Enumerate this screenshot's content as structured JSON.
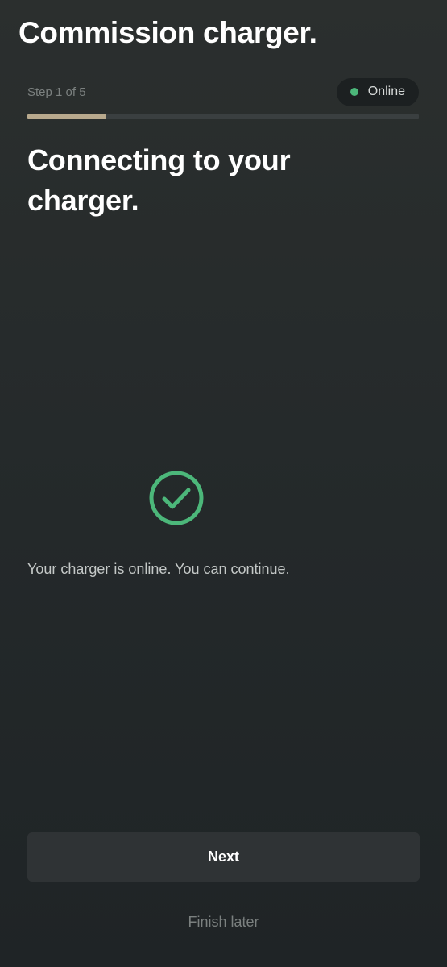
{
  "header": {
    "title": "Commission charger."
  },
  "progress": {
    "step_label": "Step 1 of 5",
    "current_step": 1,
    "total_steps": 5,
    "fraction": 0.2,
    "fill_color": "#b8a98d"
  },
  "status": {
    "label": "Online",
    "dot_color": "#4cb77a"
  },
  "main": {
    "heading": "Connecting to your charger.",
    "icon": "check-circle-icon",
    "icon_color": "#4cb77a",
    "message": "Your charger is online. You can continue."
  },
  "actions": {
    "next_label": "Next",
    "finish_later_label": "Finish later"
  }
}
